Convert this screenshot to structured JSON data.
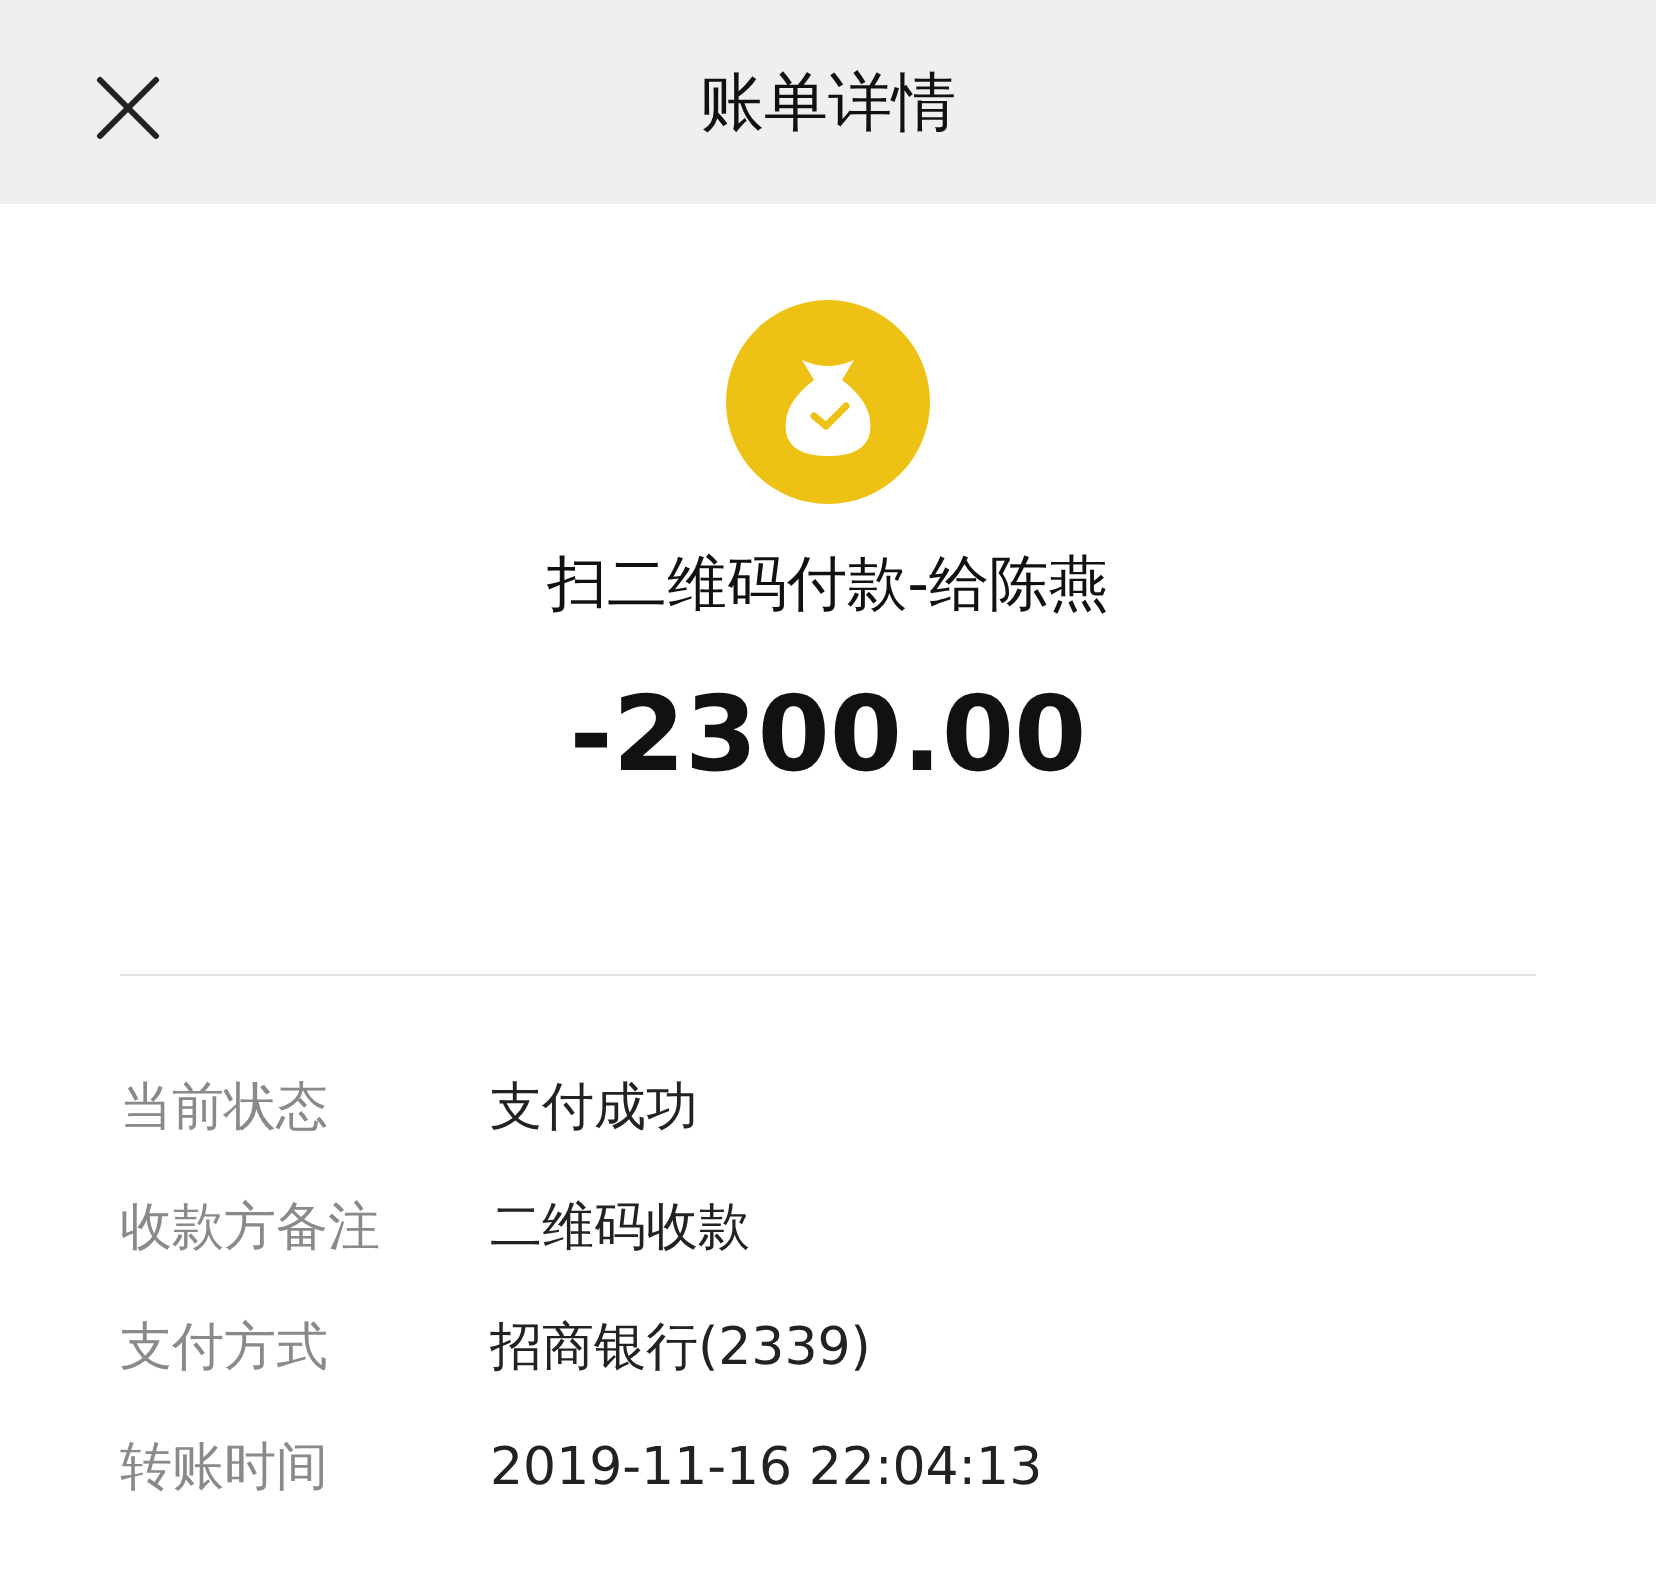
{
  "header": {
    "title": "账单详情"
  },
  "payment": {
    "title": "扫二维码付款-给陈燕",
    "amount": "-2300.00"
  },
  "details": [
    {
      "label": "当前状态",
      "value": "支付成功"
    },
    {
      "label": "收款方备注",
      "value": "二维码收款"
    },
    {
      "label": "支付方式",
      "value": "招商银行(2339)"
    },
    {
      "label": "转账时间",
      "value": "2019-11-16 22:04:13"
    }
  ]
}
